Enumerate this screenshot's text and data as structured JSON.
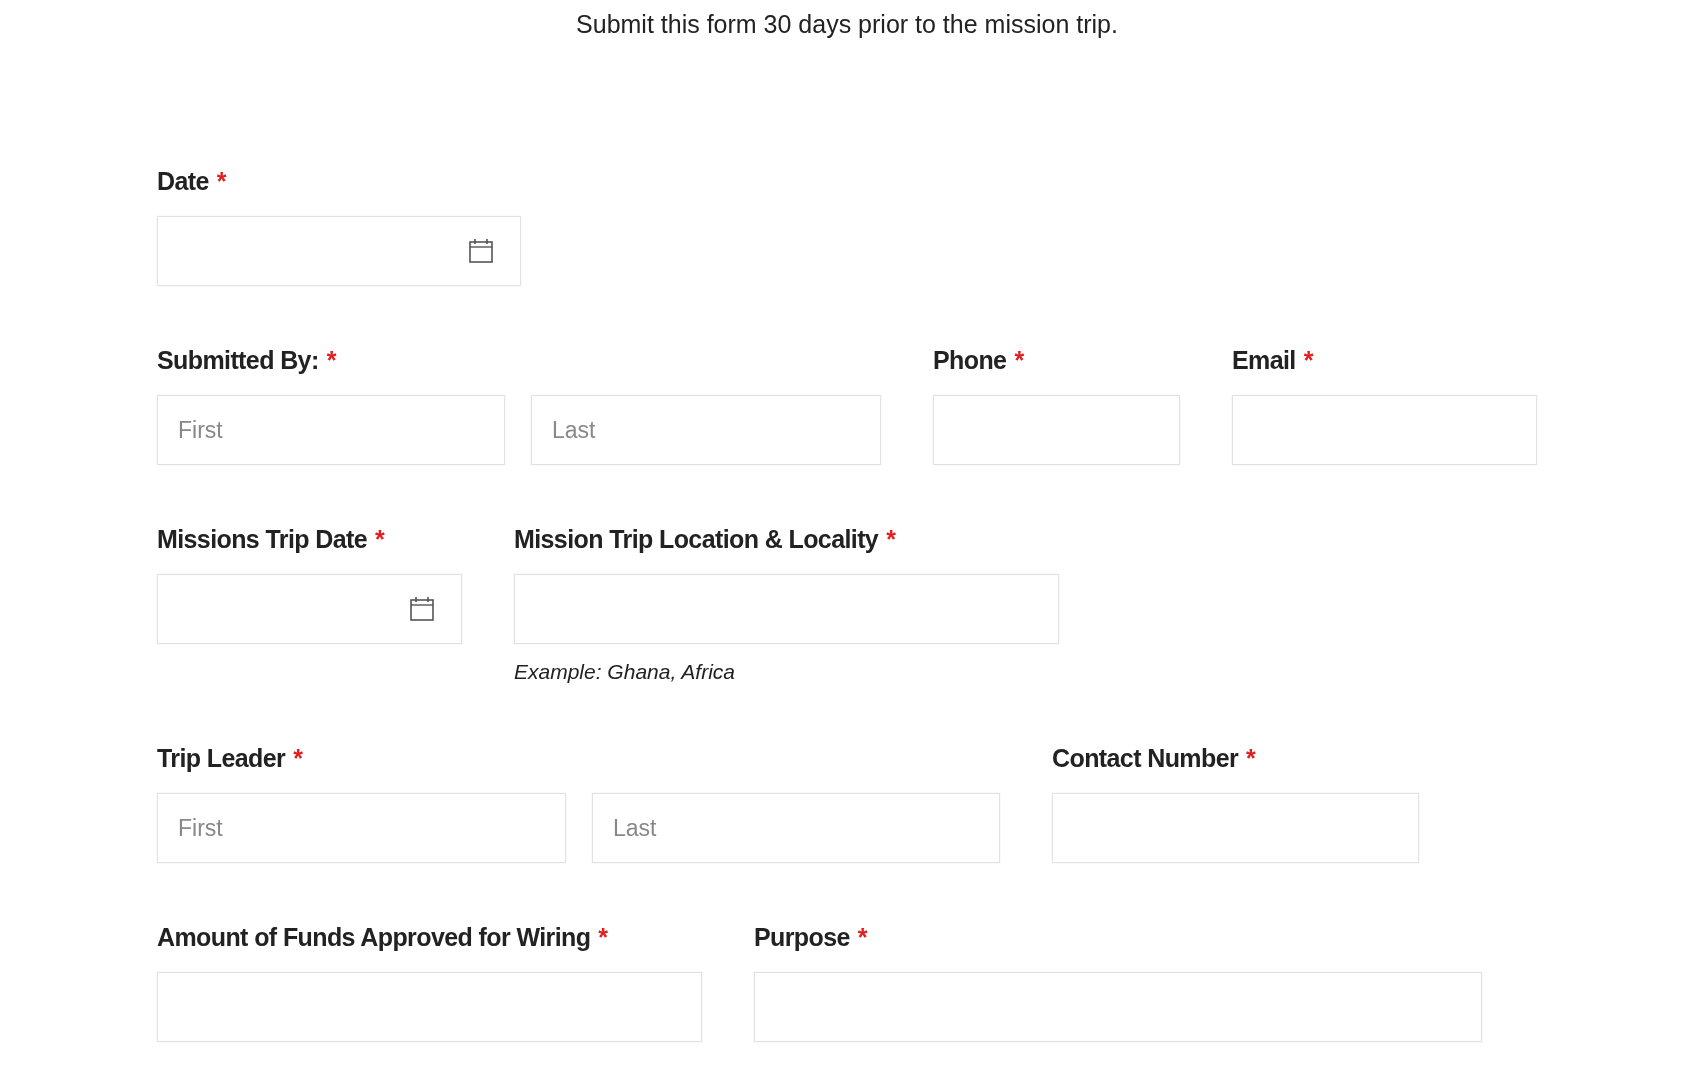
{
  "intro": "Submit this form 30 days prior to the mission trip.",
  "rows": [
    [
      {
        "label": "Date",
        "required_mark": "*",
        "kind": "date"
      }
    ],
    [
      {
        "label": "Submitted By:",
        "required_mark": "*",
        "kind": "name",
        "inputs": [
          {
            "placeholder": "First"
          },
          {
            "placeholder": "Last"
          }
        ]
      },
      {
        "label": "Phone",
        "required_mark": "*",
        "kind": "text"
      },
      {
        "label": "Email",
        "required_mark": "*",
        "kind": "text"
      }
    ],
    [
      {
        "label": "Missions Trip Date",
        "required_mark": "*",
        "kind": "date"
      },
      {
        "label": "Mission Trip Location & Locality",
        "required_mark": "*",
        "kind": "text",
        "hint": "Example: Ghana, Africa"
      }
    ],
    [
      {
        "label": "Trip Leader",
        "required_mark": "*",
        "kind": "name",
        "inputs": [
          {
            "placeholder": "First"
          },
          {
            "placeholder": "Last"
          }
        ]
      },
      {
        "label": "Contact Number",
        "required_mark": "*",
        "kind": "text"
      }
    ],
    [
      {
        "label": "Amount of Funds Approved for Wiring",
        "required_mark": "*",
        "kind": "text"
      },
      {
        "label": "Purpose",
        "required_mark": "*",
        "kind": "text"
      }
    ]
  ]
}
